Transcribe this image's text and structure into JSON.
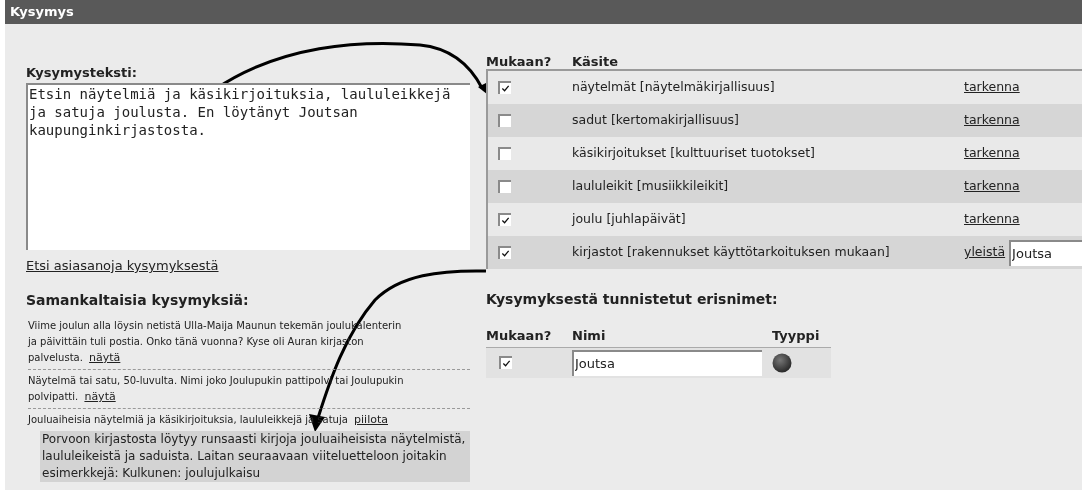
{
  "window": {
    "title": "Kysymys"
  },
  "question": {
    "label": "Kysymysteksti:",
    "value": "Etsin näytelmiä ja käsikirjoituksia, laululeikkejä ja satuja joulusta. En löytänyt Joutsan kaupunginkirjastosta.",
    "search_link": "Etsi asiasanoja kysymyksestä"
  },
  "similar": {
    "title": "Samankaltaisia kysymyksiä:",
    "items": [
      {
        "text": "Viime joulun alla löysin netistä Ulla-Maija Maunun tekemän joulukalenterin ja päivittäin tuli postia. Onko tänä vuonna? Kyse oli Auran kirjaston palvelusta.",
        "link": "näytä",
        "expanded": false
      },
      {
        "text": "Näytelmä tai satu, 50-luvulta. Nimi joko Joulupukin pattipolvi tai Joulupukin polvipatti.",
        "link": "näytä",
        "expanded": false
      },
      {
        "text": "Jouluaiheisia näytelmiä ja käsikirjoituksia, laululeikkejä ja satuja",
        "link": "piilota",
        "expanded": true,
        "answer": "Porvoon kirjastosta löytyy runsaasti kirjoja jouluaiheisista näytelmistä, laululeikeistä ja saduista. Laitan seuraavaan viiteluetteloon joitakin esimerkkejä: Kulkunen: joulujulkaisu"
      }
    ]
  },
  "concepts": {
    "columns": [
      "Mukaan?",
      "Käsite"
    ],
    "rows": [
      {
        "checked": true,
        "term": "näytelmät [näytelmäkirjallisuus]",
        "kind": "link",
        "link": "tarkenna"
      },
      {
        "checked": false,
        "term": "sadut [kertomakirjallisuus]",
        "kind": "link",
        "link": "tarkenna"
      },
      {
        "checked": false,
        "term": "käsikirjoitukset [kulttuuriset tuotokset]",
        "kind": "link",
        "link": "tarkenna"
      },
      {
        "checked": false,
        "term": "laululeikit [musiikkileikit]",
        "kind": "link",
        "link": "tarkenna"
      },
      {
        "checked": true,
        "term": "joulu [juhlapäivät]",
        "kind": "link",
        "link": "tarkenna"
      },
      {
        "checked": true,
        "term": "kirjastot [rakennukset käyttötarkoituksen mukaan]",
        "kind": "generalize",
        "link": "yleistä",
        "value": "Joutsa"
      }
    ]
  },
  "names": {
    "title": "Kysymyksestä tunnistetut erisnimet:",
    "columns": [
      "Mukaan?",
      "Nimi",
      "Tyyppi"
    ],
    "rows": [
      {
        "checked": true,
        "name": "Joutsa"
      }
    ]
  }
}
